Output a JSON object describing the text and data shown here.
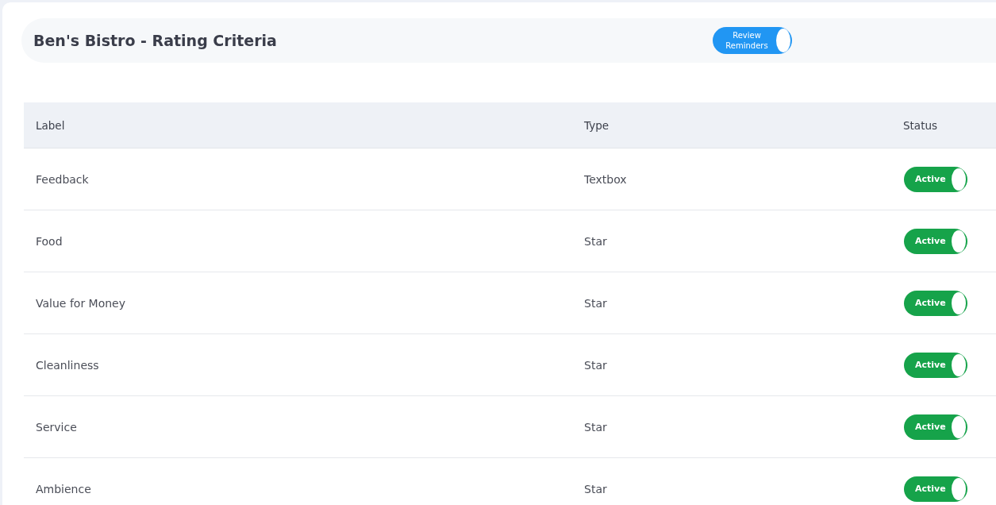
{
  "header": {
    "title": "Ben's Bistro - Rating Criteria",
    "reminder_toggle": {
      "label": "Review Reminders",
      "on": true
    }
  },
  "table": {
    "columns": [
      "Label",
      "Type",
      "Status"
    ],
    "rows": [
      {
        "label": "Feedback",
        "type": "Textbox",
        "status": {
          "label": "Active",
          "on": true
        }
      },
      {
        "label": "Food",
        "type": "Star",
        "status": {
          "label": "Active",
          "on": true
        }
      },
      {
        "label": "Value for Money",
        "type": "Star",
        "status": {
          "label": "Active",
          "on": true
        }
      },
      {
        "label": "Cleanliness",
        "type": "Star",
        "status": {
          "label": "Active",
          "on": true
        }
      },
      {
        "label": "Service",
        "type": "Star",
        "status": {
          "label": "Active",
          "on": true
        }
      },
      {
        "label": "Ambience",
        "type": "Star",
        "status": {
          "label": "Active",
          "on": true
        }
      }
    ]
  }
}
